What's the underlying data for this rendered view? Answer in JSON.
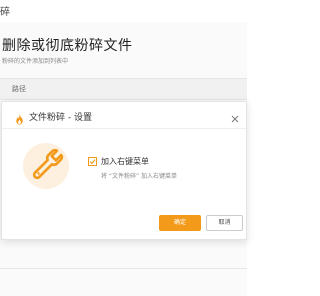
{
  "background": {
    "window_title": "碎",
    "heading": "删除或彻底粉碎文件",
    "subtitle": "粉碎的文件添加到列表中",
    "table": {
      "columns": [
        "路径"
      ]
    }
  },
  "dialog": {
    "title": "文件粉碎 - 设置",
    "option": {
      "label": "加入右键菜单",
      "checked": true,
      "description": "将 “文件粉碎” 加入右键菜单"
    },
    "buttons": {
      "ok": "确定",
      "cancel": "取消"
    }
  },
  "colors": {
    "accent": "#f39a1b",
    "tool_circle_bg": "#fdf0df"
  },
  "icons": {
    "title_icon": "flame-icon",
    "main_icon": "wrench-icon",
    "close": "close-icon"
  }
}
